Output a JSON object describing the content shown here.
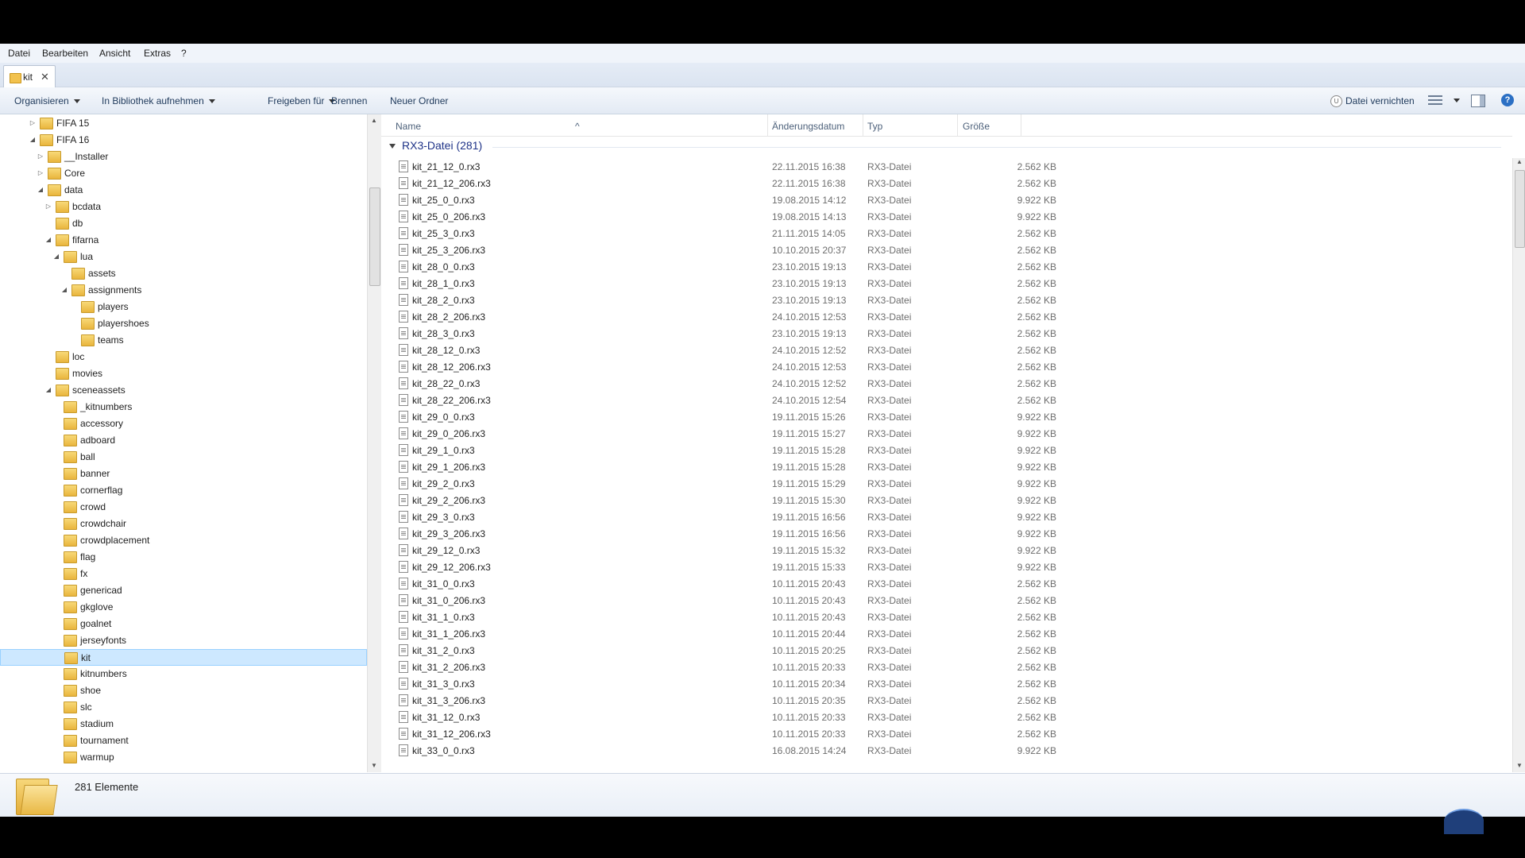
{
  "menu": [
    "Datei",
    "Bearbeiten",
    "Ansicht",
    "Extras",
    "?"
  ],
  "tab": {
    "label": "kit",
    "icon": "folder-icon"
  },
  "toolbar": {
    "organize": "Organisieren",
    "library": "In Bibliothek aufnehmen",
    "share": "Freigeben für",
    "burn": "Brennen",
    "new_folder": "Neuer Ordner",
    "shred": "Datei vernichten"
  },
  "tree": [
    {
      "label": "FIFA 15",
      "level": 0,
      "exp": "collapsed"
    },
    {
      "label": "FIFA 16",
      "level": 0,
      "exp": "expanded"
    },
    {
      "label": "__Installer",
      "level": 1,
      "exp": "collapsed"
    },
    {
      "label": "Core",
      "level": 1,
      "exp": "collapsed"
    },
    {
      "label": "data",
      "level": 1,
      "exp": "expanded"
    },
    {
      "label": "bcdata",
      "level": 2,
      "exp": "collapsed"
    },
    {
      "label": "db",
      "level": 2,
      "exp": "none"
    },
    {
      "label": "fifarna",
      "level": 2,
      "exp": "expanded"
    },
    {
      "label": "lua",
      "level": 3,
      "exp": "expanded"
    },
    {
      "label": "assets",
      "level": 4,
      "exp": "none"
    },
    {
      "label": "assignments",
      "level": 4,
      "exp": "expanded"
    },
    {
      "label": "players",
      "level": 5,
      "exp": "none"
    },
    {
      "label": "playershoes",
      "level": 5,
      "exp": "none"
    },
    {
      "label": "teams",
      "level": 5,
      "exp": "none"
    },
    {
      "label": "loc",
      "level": 2,
      "exp": "none"
    },
    {
      "label": "movies",
      "level": 2,
      "exp": "none"
    },
    {
      "label": "sceneassets",
      "level": 2,
      "exp": "expanded"
    },
    {
      "label": "_kitnumbers",
      "level": 3,
      "exp": "none"
    },
    {
      "label": "accessory",
      "level": 3,
      "exp": "none"
    },
    {
      "label": "adboard",
      "level": 3,
      "exp": "none"
    },
    {
      "label": "ball",
      "level": 3,
      "exp": "none"
    },
    {
      "label": "banner",
      "level": 3,
      "exp": "none"
    },
    {
      "label": "cornerflag",
      "level": 3,
      "exp": "none"
    },
    {
      "label": "crowd",
      "level": 3,
      "exp": "none"
    },
    {
      "label": "crowdchair",
      "level": 3,
      "exp": "none"
    },
    {
      "label": "crowdplacement",
      "level": 3,
      "exp": "none"
    },
    {
      "label": "flag",
      "level": 3,
      "exp": "none"
    },
    {
      "label": "fx",
      "level": 3,
      "exp": "none"
    },
    {
      "label": "genericad",
      "level": 3,
      "exp": "none"
    },
    {
      "label": "gkglove",
      "level": 3,
      "exp": "none"
    },
    {
      "label": "goalnet",
      "level": 3,
      "exp": "none"
    },
    {
      "label": "jerseyfonts",
      "level": 3,
      "exp": "none"
    },
    {
      "label": "kit",
      "level": 3,
      "exp": "none",
      "selected": true
    },
    {
      "label": "kitnumbers",
      "level": 3,
      "exp": "none"
    },
    {
      "label": "shoe",
      "level": 3,
      "exp": "none"
    },
    {
      "label": "slc",
      "level": 3,
      "exp": "none"
    },
    {
      "label": "stadium",
      "level": 3,
      "exp": "none"
    },
    {
      "label": "tournament",
      "level": 3,
      "exp": "none"
    },
    {
      "label": "warmup",
      "level": 3,
      "exp": "none"
    }
  ],
  "columns": {
    "name": "Name",
    "date": "Änderungsdatum",
    "type": "Typ",
    "size": "Größe"
  },
  "group_label": "RX3-Datei (281)",
  "files": [
    [
      "kit_21_12_0.rx3",
      "22.11.2015 16:38",
      "RX3-Datei",
      "2.562 KB"
    ],
    [
      "kit_21_12_206.rx3",
      "22.11.2015 16:38",
      "RX3-Datei",
      "2.562 KB"
    ],
    [
      "kit_25_0_0.rx3",
      "19.08.2015 14:12",
      "RX3-Datei",
      "9.922 KB"
    ],
    [
      "kit_25_0_206.rx3",
      "19.08.2015 14:13",
      "RX3-Datei",
      "9.922 KB"
    ],
    [
      "kit_25_3_0.rx3",
      "21.11.2015 14:05",
      "RX3-Datei",
      "2.562 KB"
    ],
    [
      "kit_25_3_206.rx3",
      "10.10.2015 20:37",
      "RX3-Datei",
      "2.562 KB"
    ],
    [
      "kit_28_0_0.rx3",
      "23.10.2015 19:13",
      "RX3-Datei",
      "2.562 KB"
    ],
    [
      "kit_28_1_0.rx3",
      "23.10.2015 19:13",
      "RX3-Datei",
      "2.562 KB"
    ],
    [
      "kit_28_2_0.rx3",
      "23.10.2015 19:13",
      "RX3-Datei",
      "2.562 KB"
    ],
    [
      "kit_28_2_206.rx3",
      "24.10.2015 12:53",
      "RX3-Datei",
      "2.562 KB"
    ],
    [
      "kit_28_3_0.rx3",
      "23.10.2015 19:13",
      "RX3-Datei",
      "2.562 KB"
    ],
    [
      "kit_28_12_0.rx3",
      "24.10.2015 12:52",
      "RX3-Datei",
      "2.562 KB"
    ],
    [
      "kit_28_12_206.rx3",
      "24.10.2015 12:53",
      "RX3-Datei",
      "2.562 KB"
    ],
    [
      "kit_28_22_0.rx3",
      "24.10.2015 12:52",
      "RX3-Datei",
      "2.562 KB"
    ],
    [
      "kit_28_22_206.rx3",
      "24.10.2015 12:54",
      "RX3-Datei",
      "2.562 KB"
    ],
    [
      "kit_29_0_0.rx3",
      "19.11.2015 15:26",
      "RX3-Datei",
      "9.922 KB"
    ],
    [
      "kit_29_0_206.rx3",
      "19.11.2015 15:27",
      "RX3-Datei",
      "9.922 KB"
    ],
    [
      "kit_29_1_0.rx3",
      "19.11.2015 15:28",
      "RX3-Datei",
      "9.922 KB"
    ],
    [
      "kit_29_1_206.rx3",
      "19.11.2015 15:28",
      "RX3-Datei",
      "9.922 KB"
    ],
    [
      "kit_29_2_0.rx3",
      "19.11.2015 15:29",
      "RX3-Datei",
      "9.922 KB"
    ],
    [
      "kit_29_2_206.rx3",
      "19.11.2015 15:30",
      "RX3-Datei",
      "9.922 KB"
    ],
    [
      "kit_29_3_0.rx3",
      "19.11.2015 16:56",
      "RX3-Datei",
      "9.922 KB"
    ],
    [
      "kit_29_3_206.rx3",
      "19.11.2015 16:56",
      "RX3-Datei",
      "9.922 KB"
    ],
    [
      "kit_29_12_0.rx3",
      "19.11.2015 15:32",
      "RX3-Datei",
      "9.922 KB"
    ],
    [
      "kit_29_12_206.rx3",
      "19.11.2015 15:33",
      "RX3-Datei",
      "9.922 KB"
    ],
    [
      "kit_31_0_0.rx3",
      "10.11.2015 20:43",
      "RX3-Datei",
      "2.562 KB"
    ],
    [
      "kit_31_0_206.rx3",
      "10.11.2015 20:43",
      "RX3-Datei",
      "2.562 KB"
    ],
    [
      "kit_31_1_0.rx3",
      "10.11.2015 20:43",
      "RX3-Datei",
      "2.562 KB"
    ],
    [
      "kit_31_1_206.rx3",
      "10.11.2015 20:44",
      "RX3-Datei",
      "2.562 KB"
    ],
    [
      "kit_31_2_0.rx3",
      "10.11.2015 20:25",
      "RX3-Datei",
      "2.562 KB"
    ],
    [
      "kit_31_2_206.rx3",
      "10.11.2015 20:33",
      "RX3-Datei",
      "2.562 KB"
    ],
    [
      "kit_31_3_0.rx3",
      "10.11.2015 20:34",
      "RX3-Datei",
      "2.562 KB"
    ],
    [
      "kit_31_3_206.rx3",
      "10.11.2015 20:35",
      "RX3-Datei",
      "2.562 KB"
    ],
    [
      "kit_31_12_0.rx3",
      "10.11.2015 20:33",
      "RX3-Datei",
      "2.562 KB"
    ],
    [
      "kit_31_12_206.rx3",
      "10.11.2015 20:33",
      "RX3-Datei",
      "2.562 KB"
    ],
    [
      "kit_33_0_0.rx3",
      "16.08.2015 14:24",
      "RX3-Datei",
      "9.922 KB"
    ]
  ],
  "status": {
    "count": "281 Elemente"
  }
}
